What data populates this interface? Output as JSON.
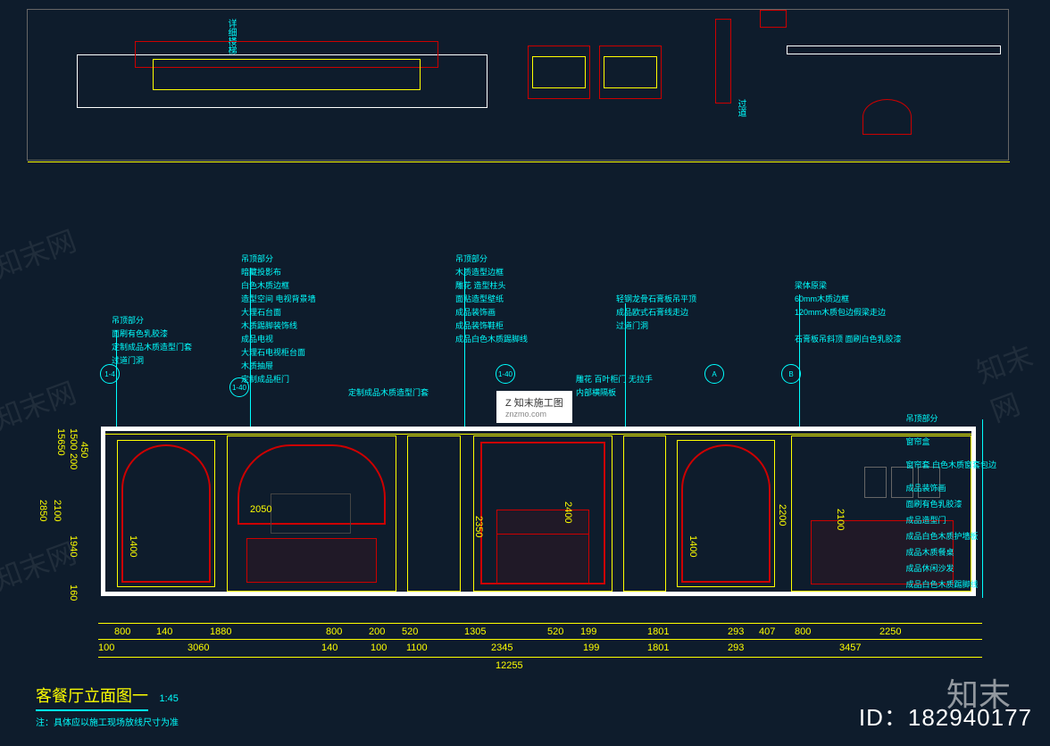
{
  "top": {
    "label1": "过道",
    "label2": "详细楼梯"
  },
  "annotations": {
    "col1": {
      "header": "吊顶部分",
      "items": [
        "面刷有色乳胶漆",
        "定制成品木质造型门套",
        "过道门洞"
      ]
    },
    "col2": {
      "header": "吊顶部分",
      "items": [
        "暗藏投影布",
        "白色木质边框",
        "造型空间 电视背景墙",
        "大理石台面",
        "木质踢脚装饰线"
      ]
    },
    "col2b": {
      "items": [
        "成品电视",
        "大理石电视柜台面",
        "木质抽屉",
        "定制成品柜门"
      ]
    },
    "col2c": "定制成品木质造型门套",
    "col3": {
      "header": "吊顶部分",
      "items": [
        "木质造型边框",
        "雕花 造型柱头",
        "面贴造型壁纸",
        "成品装饰画",
        "成品装饰鞋柜",
        "成品白色木质踢脚线"
      ]
    },
    "col3b": {
      "items": [
        "雕花 百叶柜门 无拉手",
        "内部横隔板"
      ]
    },
    "col4": {
      "items": [
        "轻钢龙骨石膏板吊平顶",
        "成品欧式石膏线走边",
        "过道门洞"
      ]
    },
    "col5": {
      "items": [
        "梁体原梁",
        "60mm木质边框",
        "120mm木质包边假梁走边"
      ]
    },
    "col5b": {
      "items": [
        "石膏板吊斜顶 面刷白色乳胶漆"
      ]
    },
    "right": {
      "header": "吊顶部分",
      "items": [
        "窗帘盒",
        "窗帘套 白色木质窗套包边",
        "成品装饰画",
        "面刷有色乳胶漆",
        "成品造型门",
        "成品白色木质护墙板",
        "成品木质餐桌",
        "成品休闲沙发",
        "成品白色木质踢脚线"
      ]
    }
  },
  "dims": {
    "v_left": [
      "1500",
      "450",
      "15650",
      "200",
      "2850",
      "2100",
      "1940",
      "160"
    ],
    "h_bottom_1": [
      "800",
      "100",
      "140",
      "1880",
      "3060",
      "800",
      "140",
      "200",
      "100",
      "520",
      "1100",
      "1305",
      "2345",
      "520",
      "199",
      "199",
      "1801",
      "1801",
      "293",
      "293",
      "407",
      "800",
      "2250",
      "3457"
    ],
    "h_total": "12255",
    "inner": [
      "1400",
      "2050",
      "2350",
      "2400",
      "1400",
      "2200",
      "2100"
    ]
  },
  "markers": [
    "1-4",
    "1-40",
    "1-40",
    "A",
    "B"
  ],
  "center_watermark": {
    "line1": "Z 知末施工图",
    "line2": "znzmo.com"
  },
  "watermarks": [
    "知末网",
    "知末网",
    "知末网",
    "知末网",
    "知末"
  ],
  "title": {
    "text": "客餐厅立面图一",
    "scale": "1:45",
    "note": "注：具体应以施工现场放线尺寸为准"
  },
  "id": "ID：182940177"
}
